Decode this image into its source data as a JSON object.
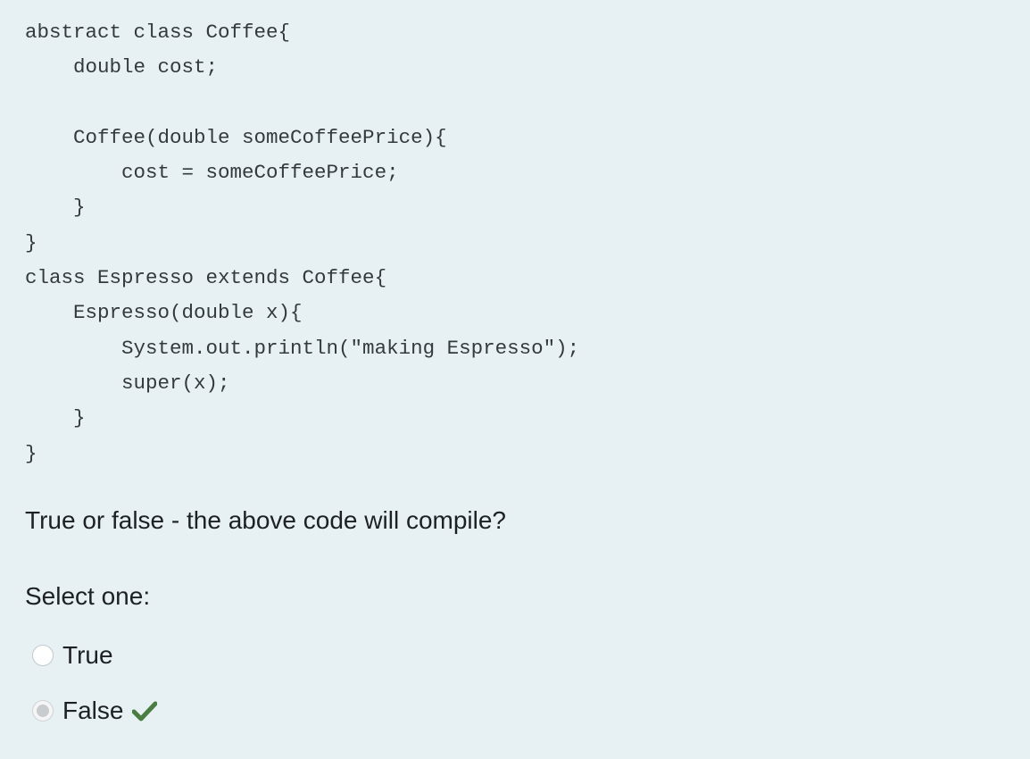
{
  "question": {
    "code_lines": [
      "abstract class Coffee{",
      "    double cost;",
      "",
      "    Coffee(double someCoffeePrice){",
      "        cost = someCoffeePrice;",
      "    }",
      "}",
      "class Espresso extends Coffee{",
      "    Espresso(double x){",
      "        System.out.println(\"making Espresso\");",
      "        super(x);",
      "    }",
      "}"
    ],
    "prompt": "True or false - the above code will compile?",
    "select_label": "Select one:",
    "options": [
      {
        "label": "True",
        "checked": false
      },
      {
        "label": "False",
        "checked": true,
        "feedback_icon": "check-icon"
      }
    ],
    "colors": {
      "background": "#e7f1f4",
      "correct": "#4a7d42"
    }
  }
}
